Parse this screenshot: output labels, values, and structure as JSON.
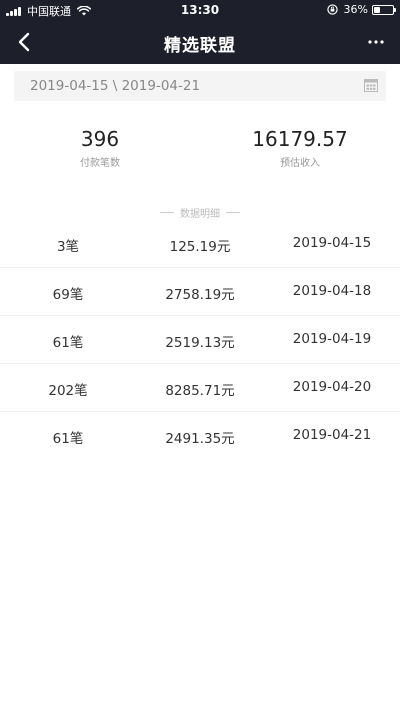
{
  "status_bar": {
    "carrier": "中国联通",
    "time": "13:30",
    "battery_percent": "36%",
    "battery_level": 0.36,
    "icons": [
      "signal-icon",
      "wifi-icon",
      "rotation-lock-icon",
      "battery-icon"
    ]
  },
  "nav": {
    "title": "精选联盟",
    "back_icon": "chevron-left-icon",
    "more_icon": "more-dots-icon"
  },
  "date_range": {
    "text": "2019-04-15 \\ 2019-04-21",
    "icon": "calendar-icon"
  },
  "summary": {
    "orders_value": "396",
    "orders_label": "付款笔数",
    "income_value": "16179.57",
    "income_label": "预估收入"
  },
  "details_heading": "数据明细",
  "rows": [
    {
      "count": "3笔",
      "amount": "125.19元",
      "date": "2019-04-15"
    },
    {
      "count": "69笔",
      "amount": "2758.19元",
      "date": "2019-04-18"
    },
    {
      "count": "61笔",
      "amount": "2519.13元",
      "date": "2019-04-19"
    },
    {
      "count": "202笔",
      "amount": "8285.71元",
      "date": "2019-04-20"
    },
    {
      "count": "61笔",
      "amount": "2491.35元",
      "date": "2019-04-21"
    }
  ],
  "colors": {
    "header_bg": "#1d1f2a",
    "text_primary": "#333333",
    "text_muted": "#999999"
  }
}
